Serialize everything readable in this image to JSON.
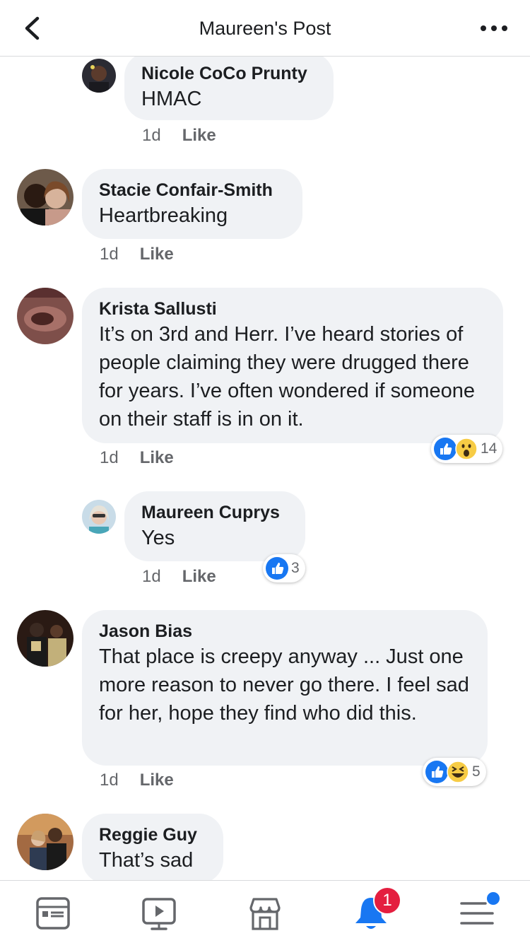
{
  "header": {
    "title": "Maureen's Post"
  },
  "comments": [
    {
      "author": "Nicole CoCo Prunty",
      "text": "HMAC",
      "time": "1d",
      "like": "Like"
    },
    {
      "author": "Stacie Confair-Smith",
      "text": "Heartbreaking",
      "time": "1d",
      "like": "Like"
    },
    {
      "author": "Krista Sallusti",
      "text": "It’s on 3rd and Herr. I’ve heard stories of people claiming they were drugged there for years. I’ve often wondered if someone on their staff is in on it.",
      "time": "1d",
      "like": "Like",
      "reaction_count": "14",
      "reactions": [
        "like",
        "wow"
      ]
    },
    {
      "author": "Maureen Cuprys",
      "text": "Yes",
      "time": "1d",
      "like": "Like",
      "reaction_count": "3",
      "reactions": [
        "like"
      ]
    },
    {
      "author": "Jason Bias",
      "text": "That place is creepy anyway ... Just one more reason to never go there. I feel sad for her, hope they find who did this.",
      "time": "1d",
      "like": "Like",
      "reaction_count": "5",
      "reactions": [
        "like",
        "haha"
      ]
    },
    {
      "author": "Reggie Guy",
      "text": "That’s sad"
    }
  ],
  "tabbar": {
    "tabs": [
      "news-feed-icon",
      "watch-icon",
      "marketplace-icon",
      "notifications-bell-icon",
      "menu-icon"
    ],
    "notification_badge": "1"
  },
  "colors": {
    "accent": "#1877f2",
    "badge": "#e41e3f",
    "bubble": "#f0f2f5",
    "meta": "#65676b"
  }
}
